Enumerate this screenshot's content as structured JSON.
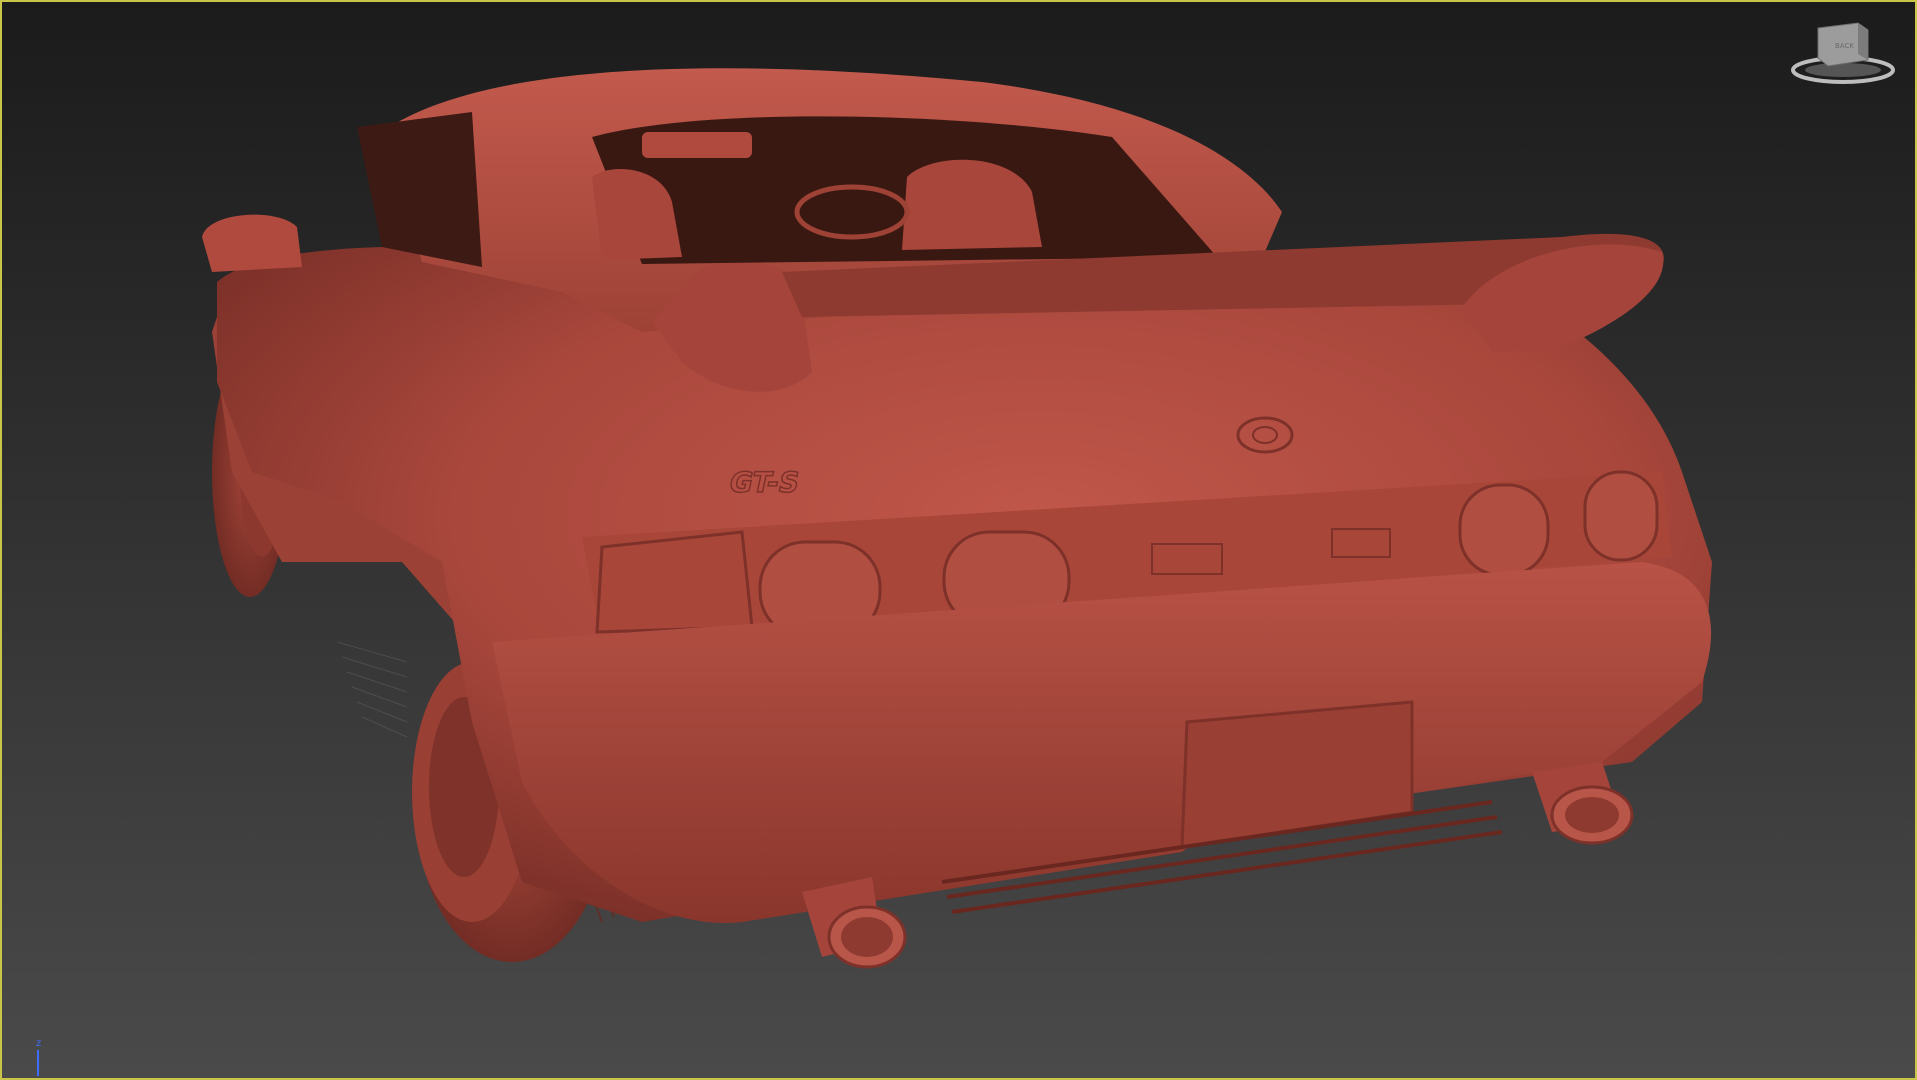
{
  "viewport": {
    "border_color": "#c9c44a",
    "model_color": "#b04a3e"
  },
  "viewcube": {
    "face_label": "BACK"
  },
  "axis_gizmo": {
    "label": "z",
    "color": "#3d6cff"
  },
  "model": {
    "badge_text": "GT-S"
  }
}
